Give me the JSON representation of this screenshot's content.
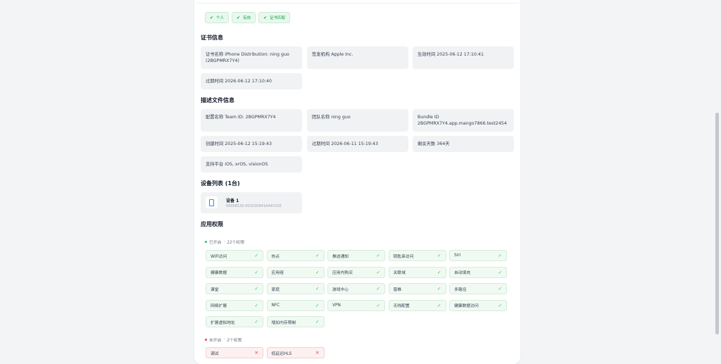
{
  "chips": [
    {
      "label": "个人",
      "icon": "check-icon"
    },
    {
      "label": "有效",
      "icon": "check-icon"
    },
    {
      "label": "证书匹配",
      "icon": "check-icon"
    }
  ],
  "cert": {
    "title": "证书信息",
    "name": "证书名称 iPhone Distribution: ning guo (2BGPMRX7Y4)",
    "issuer": "签发机构 Apple Inc.",
    "effective": "生效时间 2025-06-12 17:10:41",
    "expire": "过期时间 2026-06-12 17:10:40"
  },
  "profile": {
    "title": "描述文件信息",
    "config_name": "配置名称 Team ID: 2BGPMRX7Y4",
    "team_name": "团队名称 ning guo",
    "bundle_label": "Bundle ID",
    "bundle_value": "2BGPMRX7Y4.app.mango7866.test2454",
    "created": "创建时间 2025-06-12 15:19:43",
    "expire": "过期时间 2026-06-11 15:19:43",
    "remaining": "剩余天数 364天",
    "platforms": "支持平台 iOS, xrOS, visionOS"
  },
  "devices": {
    "title": "设备列表 (1台)",
    "items": [
      {
        "name": "设备 1",
        "id": "00008120-001020941A44C01E"
      }
    ]
  },
  "permissions": {
    "title": "应用权限",
    "enabled_label": "已开启",
    "enabled_count": "22个权限",
    "enabled": [
      "WiFi访问",
      "热点",
      "推送通知",
      "钥匙串访问",
      "Siri",
      "健康数据",
      "应用组",
      "应用内购买",
      "关联域",
      "自动填充",
      "课堂",
      "家庭",
      "游戏中心",
      "普推",
      "多路径",
      "网络扩展",
      "NFC",
      "VPN",
      "无线配置",
      "健康数据访问",
      "扩展虚拟地址",
      "增加内存限制"
    ],
    "disabled_label": "未开启",
    "disabled_count": "2个权限",
    "disabled": [
      "调试",
      "低延迟HLS"
    ]
  },
  "colors": {
    "accent_green": "#22c55e",
    "accent_red": "#ef4444",
    "accent_blue": "#3b82f6"
  }
}
